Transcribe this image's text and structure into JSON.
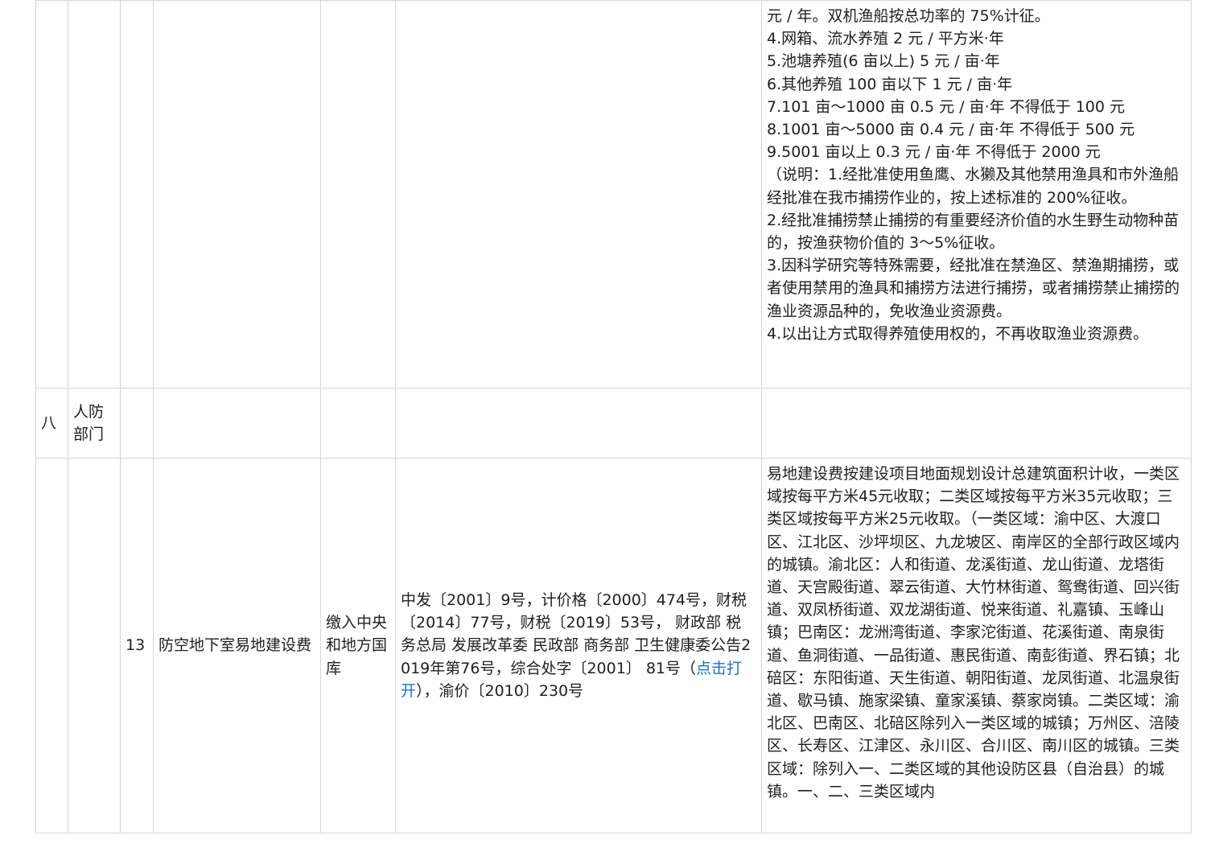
{
  "section_8": {
    "number": "八",
    "department": "人防部门"
  },
  "item_13": {
    "index": "13",
    "name": "防空地下室易地建设费",
    "treasury": "缴入中央和地方国库",
    "basis_before_link": "中发〔2001〕9号，计价格〔2000〕474号，财税〔2014〕77号，财税〔2019〕53号， 财政部 税务总局 发展改革委 民政部 商务部 卫生健康委公告2019年第76号，综合处字〔2001〕 81号（",
    "basis_link": "点击打开",
    "basis_after_link": "），渝价〔2010〕230号",
    "standard": "易地建设费按建设项目地面规划设计总建筑面积计收，一类区域按每平方米45元收取；二类区域按每平方米35元收取；三类区域按每平方米25元收取。（一类区域：渝中区、大渡口区、江北区、沙坪坝区、九龙坡区、南岸区的全部行政区域内的城镇。渝北区：人和街道、龙溪街道、龙山街道、龙塔街道、天宫殿街道、翠云街道、大竹林街道、鸳鸯街道、回兴街道、双凤桥街道、双龙湖街道、悦来街道、礼嘉镇、玉峰山镇；巴南区：龙洲湾街道、李家沱街道、花溪街道、南泉街道、鱼洞街道、一品街道、惠民街道、南彭街道、界石镇；北碚区：东阳街道、天生街道、朝阳街道、龙凤街道、北温泉街道、歇马镇、施家梁镇、童家溪镇、蔡家岗镇。二类区域：渝北区、巴南区、北碚区除列入一类区域的城镇；万州区、涪陵区、长寿区、江津区、永川区、合川区、南川区的城镇。三类区域：除列入一、二类区域的其他设防区县（自治县）的城镇。一、二、三类区域内"
  },
  "continued_standard_lines": [
    "元 / 年。双机渔船按总功率的 75%计征。",
    "4.网箱、流水养殖 2 元 / 平方米·年",
    "5.池塘养殖(6 亩以上) 5 元 / 亩·年",
    "6.其他养殖 100 亩以下 1 元 / 亩·年",
    "7.101 亩～1000 亩 0.5 元 / 亩·年 不得低于 100 元",
    "8.1001 亩～5000 亩 0.4 元 / 亩·年 不得低于 500 元",
    "9.5001 亩以上 0.3 元 / 亩·年 不得低于 2000 元",
    "（说明：1.经批准使用鱼鹰、水獭及其他禁用渔具和市外渔船经批准在我市捕捞作业的，按上述标准的 200%征收。",
    "2.经批准捕捞禁止捕捞的有重要经济价值的水生野生动物种苗的，按渔获物价值的 3～5%征收。",
    "3.因科学研究等特殊需要，经批准在禁渔区、禁渔期捕捞，或者使用禁用的渔具和捕捞方法进行捕捞，或者捕捞禁止捕捞的渔业资源品种的，免收渔业资源费。",
    "4.以出让方式取得养殖使用权的，不再收取渔业资源费。"
  ]
}
